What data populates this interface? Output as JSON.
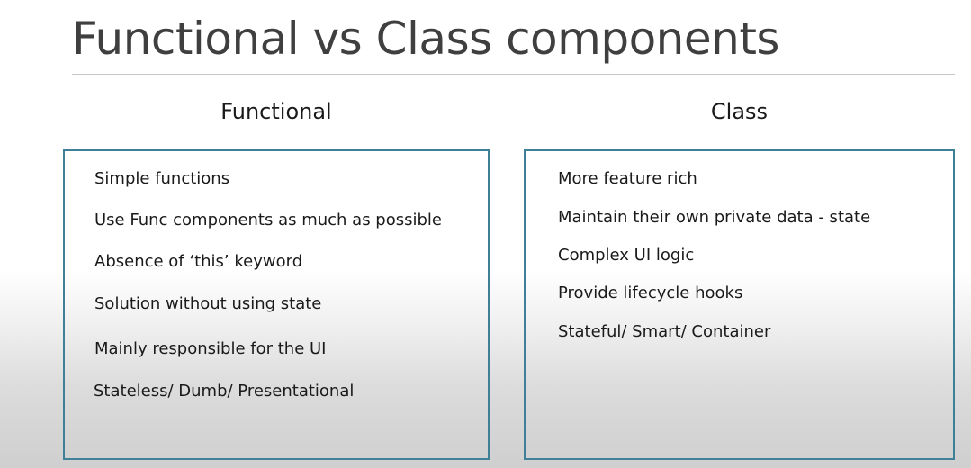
{
  "slide": {
    "title": "Functional vs Class components"
  },
  "functional": {
    "heading": "Functional",
    "items": [
      "Simple functions",
      "Use Func components as much as possible",
      "Absence of ‘this’ keyword",
      "Solution without using state",
      "Mainly responsible for the UI",
      "Stateless/ Dumb/ Presentational"
    ]
  },
  "class": {
    "heading": "Class",
    "items": [
      "More feature rich",
      "Maintain their own private data - state",
      "Complex UI logic",
      "Provide lifecycle hooks",
      "Stateful/ Smart/ Container"
    ]
  }
}
